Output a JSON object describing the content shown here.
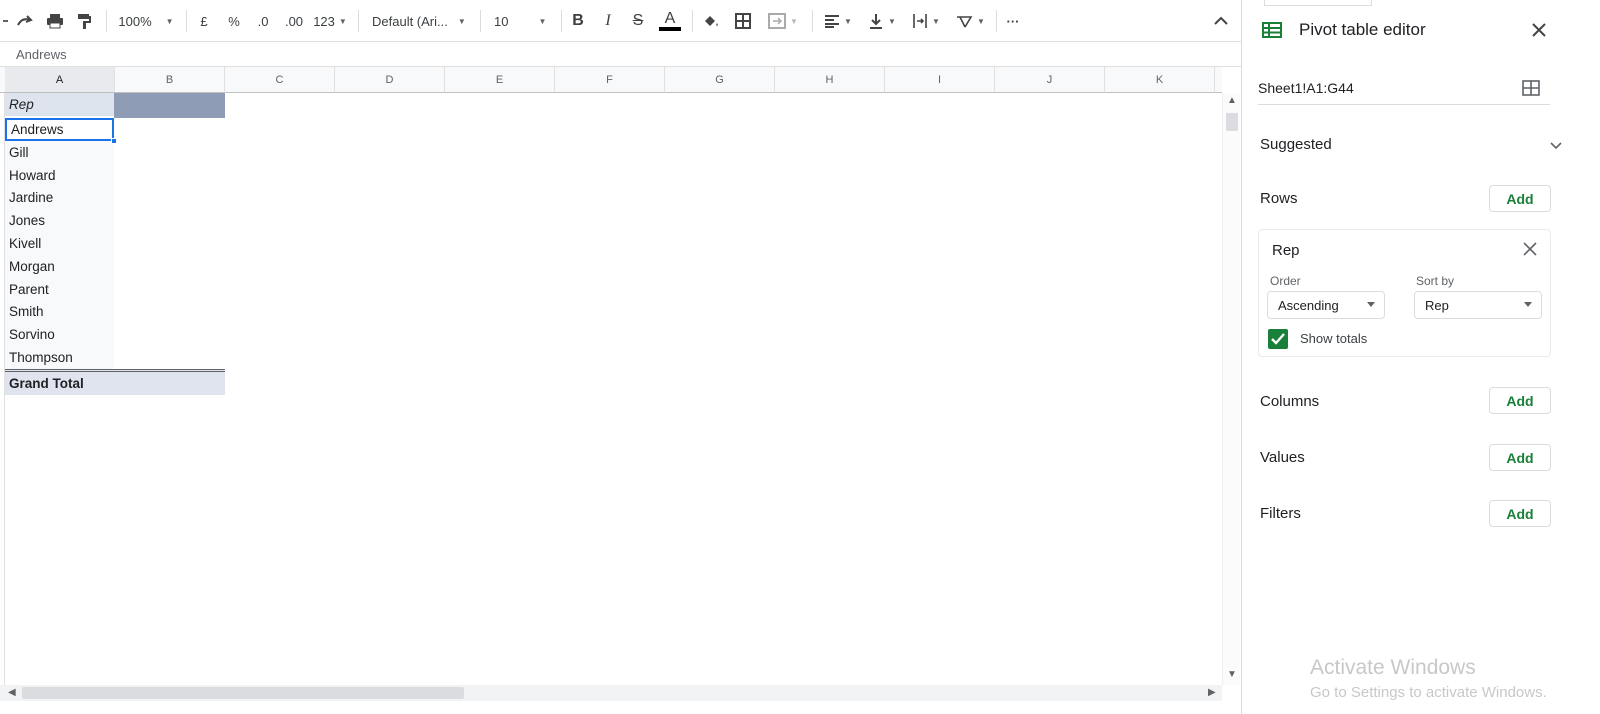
{
  "toolbar": {
    "zoom": "100%",
    "currency": "£",
    "percent": "%",
    "decrease_decimals": ".0",
    "increase_decimals": ".00",
    "more_formats": "123",
    "font": "Default (Ari...",
    "font_size": "10",
    "more": "···"
  },
  "formula_bar": {
    "value": "Andrews"
  },
  "columns": [
    "A",
    "B",
    "C",
    "D",
    "E",
    "F",
    "G",
    "H",
    "I",
    "J",
    "K"
  ],
  "pivot": {
    "header": "Rep",
    "rows": [
      "Andrews",
      "Gill",
      "Howard",
      "Jardine",
      "Jones",
      "Kivell",
      "Morgan",
      "Parent",
      "Smith",
      "Sorvino",
      "Thompson"
    ],
    "grand_total": "Grand Total"
  },
  "panel": {
    "title": "Pivot table editor",
    "range": "Sheet1!A1:G44",
    "suggested": "Suggested",
    "rows_label": "Rows",
    "columns_label": "Columns",
    "values_label": "Values",
    "filters_label": "Filters",
    "add_label": "Add",
    "row_card": {
      "title": "Rep",
      "order_label": "Order",
      "order_value": "Ascending",
      "sort_label": "Sort by",
      "sort_value": "Rep",
      "show_totals": "Show totals",
      "show_totals_checked": true
    }
  },
  "watermark": {
    "line1": "Activate Windows",
    "line2": "Go to Settings to activate Windows."
  },
  "colors": {
    "accent": "#1a73e8",
    "green": "#188038",
    "pivot_header": "#dee4ee"
  }
}
